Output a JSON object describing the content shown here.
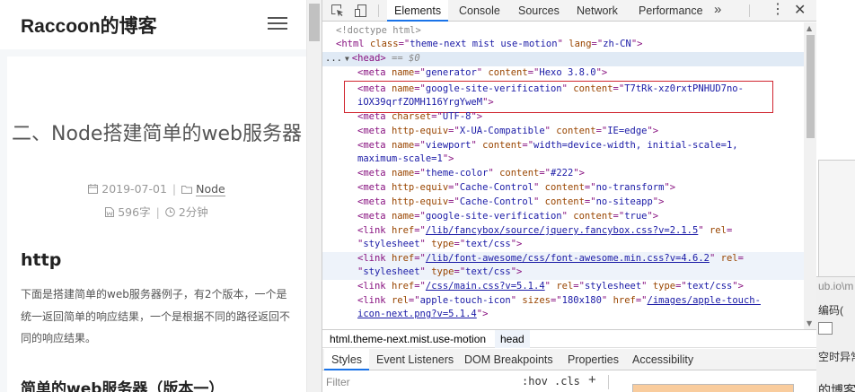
{
  "blog": {
    "site_title": "Raccoon的博客",
    "post_title": "二、Node搭建简单的web服务器",
    "date": "2019-07-01",
    "category": "Node",
    "word_count": "596字",
    "read_time": "2分钟",
    "section_heading": "http",
    "paragraph": "下面是搭建简单的web服务器例子，有2个版本，一个是统一返回简单的响应结果，一个是根据不同的路径返回不同的响应结果。",
    "sub_heading": "简单的web服务器（版本一）"
  },
  "devtools": {
    "tabs": [
      "Elements",
      "Console",
      "Sources",
      "Network",
      "Performance"
    ],
    "active_tab": "Elements",
    "more_symbol": "»",
    "menu_symbol": "⋮",
    "close_symbol": "✕",
    "dom": {
      "doctype": "<!doctype html>",
      "html_open": {
        "tag": "html",
        "attrs": [
          [
            "class",
            "theme-next mist use-motion"
          ],
          [
            "lang",
            "zh-CN"
          ]
        ]
      },
      "head_dots": "...",
      "head_tag": "<head>",
      "head_marker": " == $0",
      "meta_generator": {
        "name": "generator",
        "content": "Hexo 3.8.0"
      },
      "meta_gsv": {
        "name": "google-site-verification",
        "content_1": "T7tRk-xz0rxtPNHUD7no-",
        "content_2": "iOX39qrfZOMH116YrgYweM"
      },
      "meta_charset": {
        "charset": "UTF-8"
      },
      "meta_compat": {
        "http_equiv": "X-UA-Compatible",
        "content": "IE=edge"
      },
      "meta_viewport": {
        "name": "viewport",
        "content_1": "width=device-width, initial-scale=1,",
        "content_2": "maximum-scale=1"
      },
      "meta_theme": {
        "name": "theme-color",
        "content": "#222"
      },
      "meta_cache1": {
        "http_equiv": "Cache-Control",
        "content": "no-transform"
      },
      "meta_cache2": {
        "http_equiv": "Cache-Control",
        "content": "no-siteapp"
      },
      "meta_gsv2": {
        "name": "google-site-verification",
        "content": "true"
      },
      "link_fancybox": {
        "href": "/lib/fancybox/source/jquery.fancybox.css?v=2.1.5",
        "rel": "stylesheet",
        "type": "text/css"
      },
      "link_fa": {
        "href": "/lib/font-awesome/css/font-awesome.min.css?v=4.6.2",
        "rel": "stylesheet",
        "type": "text/css"
      },
      "link_main": {
        "href": "/css/main.css?v=5.1.4",
        "rel": "stylesheet",
        "type": "text/css"
      },
      "link_apple": {
        "rel": "apple-touch-icon",
        "sizes": "180x180",
        "href_1": "/images/apple-touch-",
        "href_2": "icon-next.png?v=5.1.4"
      }
    },
    "breadcrumb": [
      "html.theme-next.mist.use-motion",
      "head"
    ],
    "sub_tabs": [
      "Styles",
      "Event Listeners",
      "DOM Breakpoints",
      "Properties",
      "Accessibility"
    ],
    "active_sub_tab": "Styles",
    "filter_placeholder": "Filter",
    "hov_label": ":hov",
    "cls_label": ".cls",
    "plus_label": "+"
  },
  "background": {
    "url_fragment": "ub.io\\m",
    "encoding_label": "编码(",
    "error_label": "空时异常",
    "blog_fragment": "的博客"
  },
  "colors": {
    "accent": "#1a73e8",
    "highlight_box": "#d0252f",
    "tag": "#881280",
    "attr_name": "#994500",
    "attr_value": "#1a1aa6"
  }
}
